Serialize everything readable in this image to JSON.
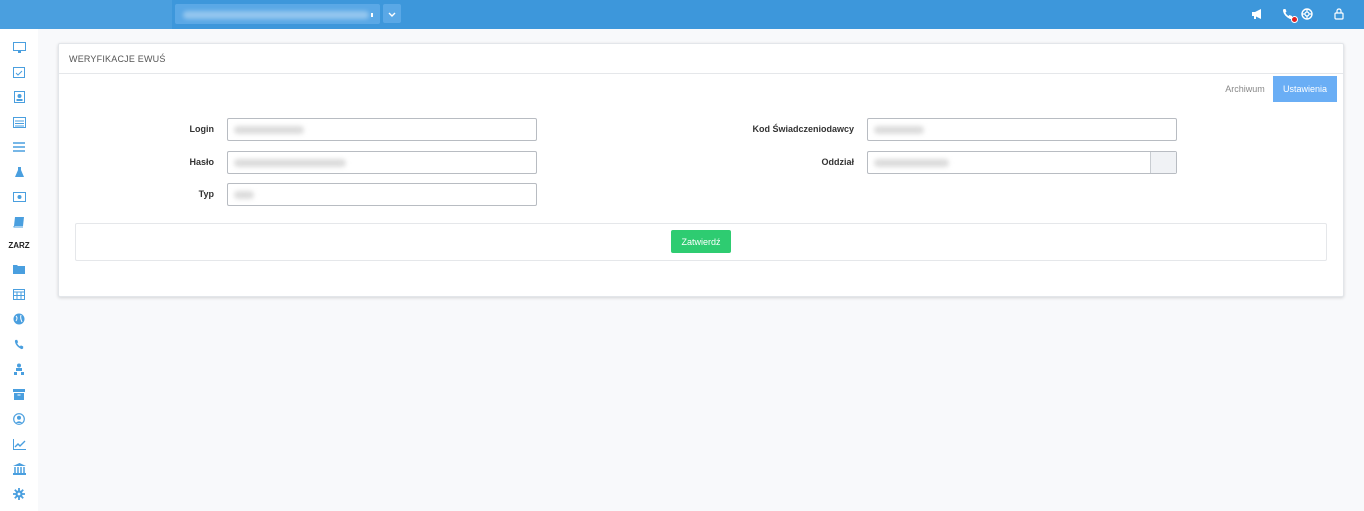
{
  "header": {
    "organization_select_value": "",
    "icons": [
      "megaphone-icon",
      "phone-icon",
      "lifebuoy-icon",
      "lock-icon"
    ]
  },
  "sidebar": {
    "section_label": "ZARZ",
    "icons": [
      "monitor-icon",
      "calendar-check-icon",
      "contact-card-icon",
      "list-icon",
      "menu-icon",
      "flask-icon",
      "money-icon",
      "book-icon",
      "folder-icon",
      "calendar-icon",
      "globe-icon",
      "phone-icon",
      "user-hierarchy-icon",
      "archive-icon",
      "user-circle-icon",
      "chart-line-icon",
      "bank-icon",
      "gear-icon"
    ]
  },
  "card": {
    "title": "WERYFIKACJE EWUŚ",
    "tabs": {
      "archiwum": "Archiwum",
      "ustawienia": "Ustawienia"
    }
  },
  "form": {
    "login_label": "Login",
    "haslo_label": "Hasło",
    "typ_label": "Typ",
    "kod_label": "Kod Świadczeniodawcy",
    "oddzial_label": "Oddział",
    "submit_label": "Zatwierdź"
  },
  "colors": {
    "topbar": "#3d97db",
    "accent_tab": "#6aaef5",
    "submit": "#2ecc71",
    "sidebar_icon": "#4a9fdf"
  }
}
